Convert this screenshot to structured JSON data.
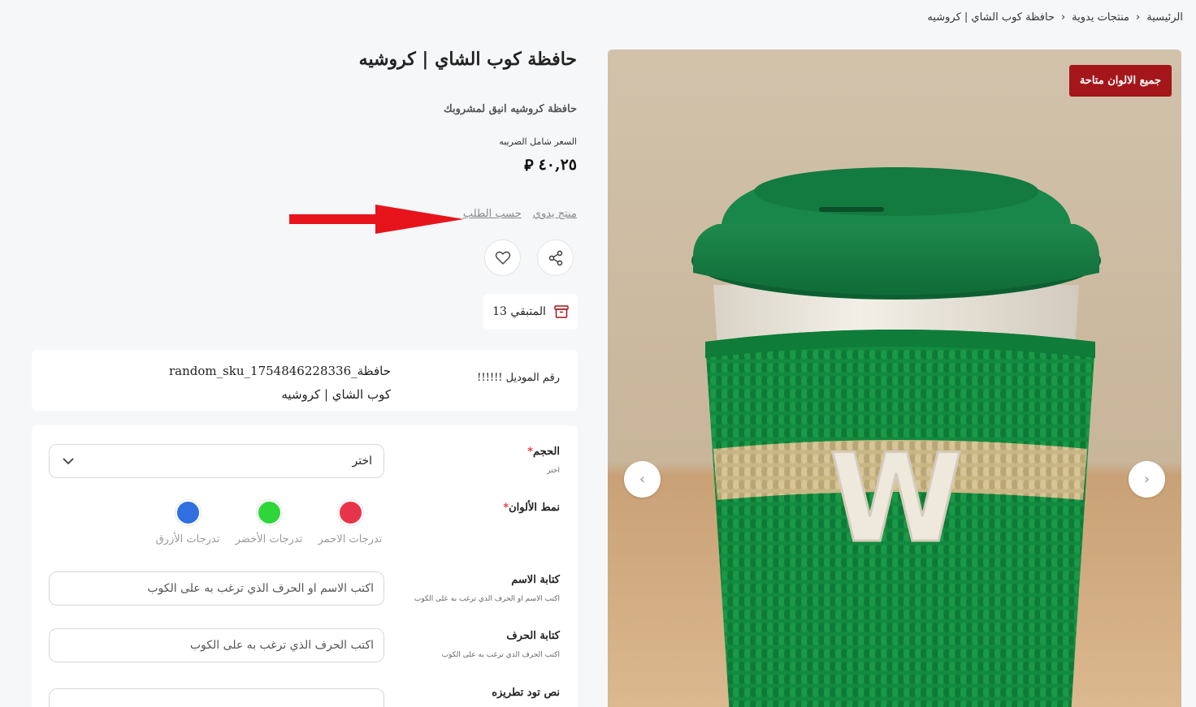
{
  "breadcrumb": {
    "home": "الرئيسية",
    "category": "منتجات يدوية",
    "current": "حافظة كوب الشاي | كروشيه",
    "separator": "›"
  },
  "product": {
    "title": "حافظة كوب الشاي | كروشيه",
    "subtitle": "حافظة كروشيه انيق لمشروبك",
    "price_label": "السعر شامل الضريبه",
    "price": "٤٠,٢٥",
    "currency_symbol": "⃁",
    "tags": [
      "منتج يدوي",
      "حسب الطلب"
    ],
    "stock_text": "المتبقي 13",
    "badge": "جميع الالوان متاحة",
    "sku_label": "!!!!!! رقم الموديل",
    "sku_value_line1": "حافظة_random_sku_1754846228336",
    "sku_value_line2": "كوب الشاي | كروشيه",
    "image_letter": "W"
  },
  "options": {
    "size": {
      "label": "الحجم",
      "required": "*",
      "hint": "اختر",
      "selected": "اختر"
    },
    "colors": {
      "label": "نمط الألوان",
      "required": "*",
      "items": [
        {
          "name": "تدرجات الاحمر",
          "color": "#e8344a"
        },
        {
          "name": "تدرجات الأخضر",
          "color": "#2fd63a"
        },
        {
          "name": "تدرجات الأزرق",
          "color": "#2f6fe0"
        }
      ]
    },
    "name_text": {
      "label": "كتابة الاسم",
      "hint": "اكتب الاسم او الحرف الذي ترغب به على الكوب",
      "placeholder": "اكتب الاسم او الحرف الذي ترغب به على الكوب"
    },
    "letter_text": {
      "label": "كتابة الحرف",
      "hint": "اكتب الحرف الذي ترغب به على الكوب",
      "placeholder": "اكتب الحرف الذي ترغب به على الكوب"
    },
    "embroidery": {
      "label": "نص تود تطريزه"
    }
  },
  "colors": {
    "badge_bg": "#a4161a",
    "annotation_arrow": "#e8141b",
    "icon": "#a4161a"
  }
}
